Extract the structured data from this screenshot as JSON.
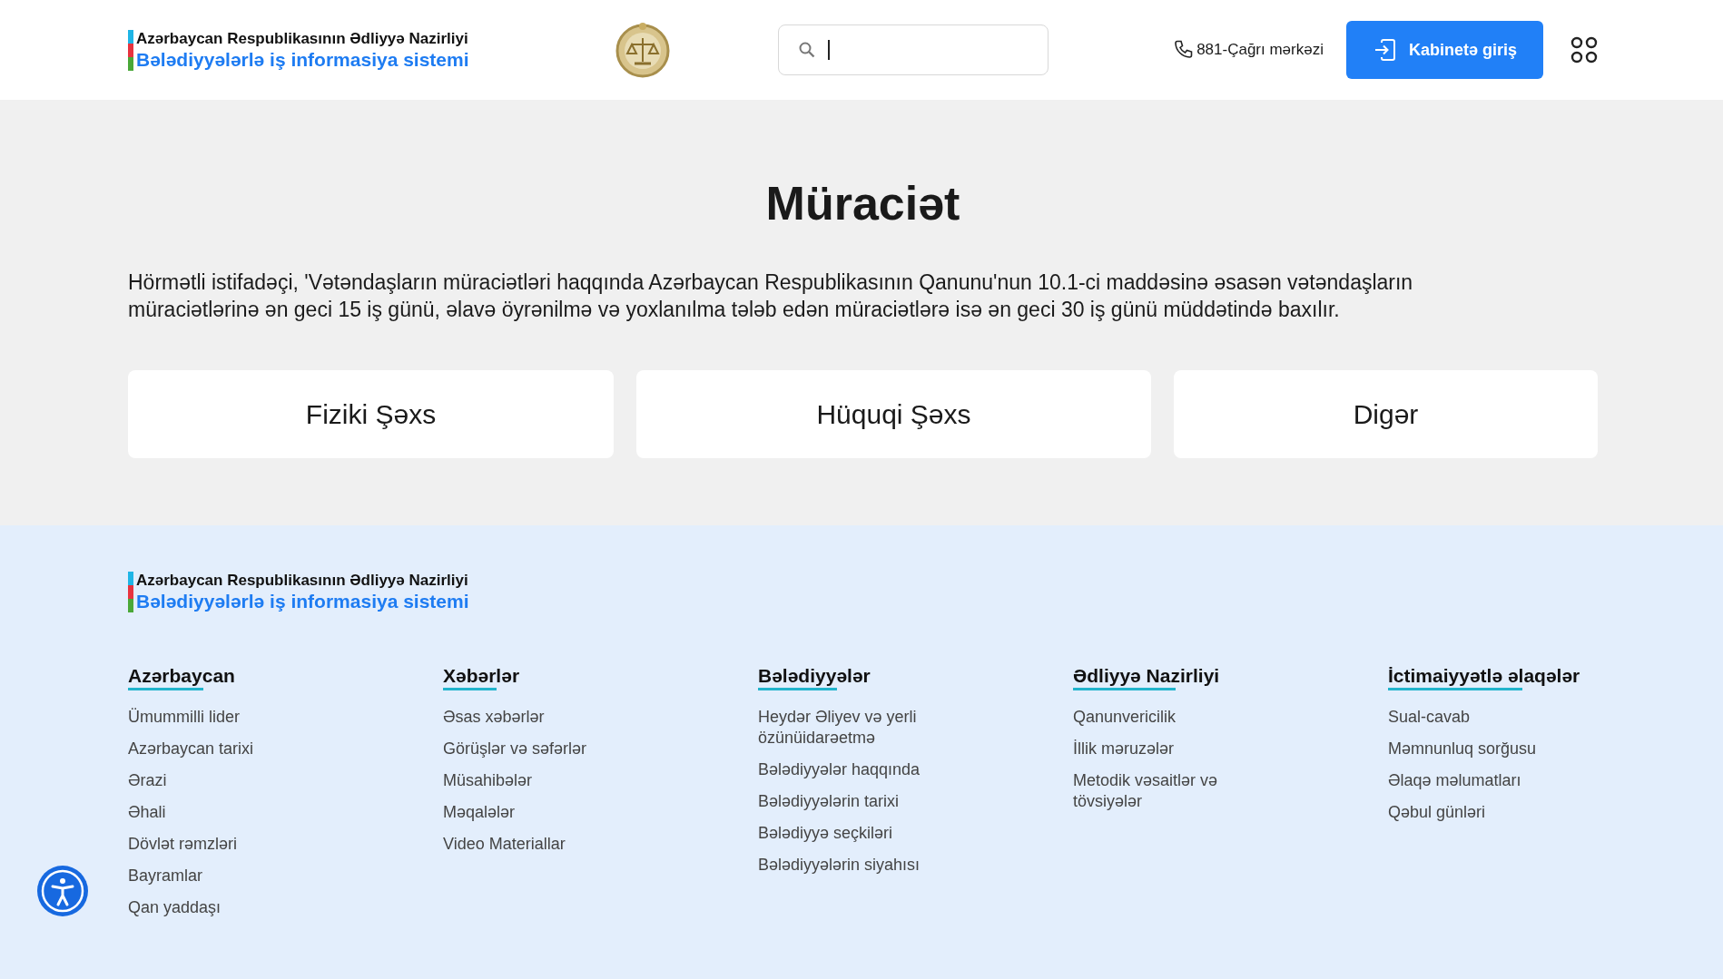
{
  "header": {
    "logo": {
      "ministry": "Azərbaycan Respublikasının Ədliyyə Nazirliyi",
      "system": "Bələdiyyələrlə iş informasiya sistemi"
    },
    "call_center": "881-Çağrı mərkəzi",
    "login_button": "Kabinetə giriş"
  },
  "appeal": {
    "title": "Müraciət",
    "notice": "Hörmətli istifadəçi, 'Vətəndaşların müraciətləri haqqında Azərbaycan Respublikasının Qanunu'nun 10.1-ci maddəsinə əsasən vətəndaşların müraciətlərinə ən geci 15 iş günü, əlavə öyrənilmə və yoxlanılma tələb edən müraciətlərə isə ən geci 30 iş günü müddətində baxılır.",
    "options": [
      "Fiziki Şəxs",
      "Hüquqi Şəxs",
      "Digər"
    ]
  },
  "footer": {
    "logo": {
      "ministry": "Azərbaycan Respublikasının Ədliyyə Nazirliyi",
      "system": "Bələdiyyələrlə iş informasiya sistemi"
    },
    "columns": [
      {
        "title": "Azərbaycan",
        "links": [
          "Ümummilli lider",
          "Azərbaycan tarixi",
          "Ərazi",
          "Əhali",
          "Dövlət rəmzləri",
          "Bayramlar",
          "Qan yaddaşı"
        ]
      },
      {
        "title": "Xəbərlər",
        "links": [
          "Əsas xəbərlər",
          "Görüşlər və səfərlər",
          "Müsahibələr",
          "Məqalələr",
          "Video Materiallar"
        ]
      },
      {
        "title": "Bələdiyyələr",
        "links": [
          "Heydər Əliyev və yerli özünüidarəetmə",
          "Bələdiyyələr haqqında",
          "Bələdiyyələrin tarixi",
          "Bələdiyyə seçkiləri",
          "Bələdiyyələrin siyahısı"
        ]
      },
      {
        "title": "Ədliyyə Nazirliyi",
        "links": [
          "Qanunvericilik",
          "İllik məruzələr",
          "Metodik vəsaitlər və tövsiyələr"
        ]
      },
      {
        "title": "İctimaiyyətlə əlaqələr",
        "links": [
          "Sual-cavab",
          "Məmnunluq sorğusu",
          "Əlaqə məlumatları",
          "Qəbul günləri"
        ]
      }
    ]
  }
}
